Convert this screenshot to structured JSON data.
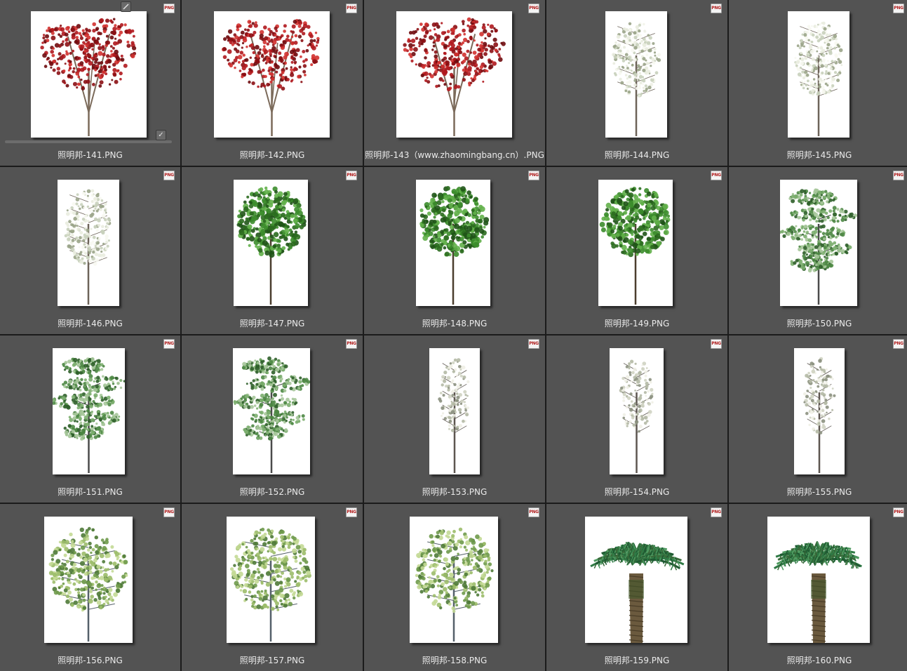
{
  "badge_text": "PNG",
  "check_glyph": "✓",
  "items": [
    {
      "name": "照明邦-141.PNG",
      "tree": "red",
      "selected": true
    },
    {
      "name": "照明邦-142.PNG",
      "tree": "red"
    },
    {
      "name": "照明邦-143（www.zhaomingbang.cn）.PNG",
      "tree": "red"
    },
    {
      "name": "照明邦-144.PNG",
      "tree": "white"
    },
    {
      "name": "照明邦-145.PNG",
      "tree": "white"
    },
    {
      "name": "照明邦-146.PNG",
      "tree": "white"
    },
    {
      "name": "照明邦-147.PNG",
      "tree": "green"
    },
    {
      "name": "照明邦-148.PNG",
      "tree": "green"
    },
    {
      "name": "照明邦-149.PNG",
      "tree": "green"
    },
    {
      "name": "照明邦-150.PNG",
      "tree": "pine"
    },
    {
      "name": "照明邦-151.PNG",
      "tree": "pine"
    },
    {
      "name": "照明邦-152.PNG",
      "tree": "pine"
    },
    {
      "name": "照明邦-153.PNG",
      "tree": "blossom"
    },
    {
      "name": "照明邦-154.PNG",
      "tree": "blossom"
    },
    {
      "name": "照明邦-155.PNG",
      "tree": "blossom"
    },
    {
      "name": "照明邦-156.PNG",
      "tree": "light"
    },
    {
      "name": "照明邦-157.PNG",
      "tree": "light"
    },
    {
      "name": "照明邦-158.PNG",
      "tree": "light"
    },
    {
      "name": "照明邦-159.PNG",
      "tree": "palm"
    },
    {
      "name": "照明邦-160.PNG",
      "tree": "palm"
    }
  ]
}
